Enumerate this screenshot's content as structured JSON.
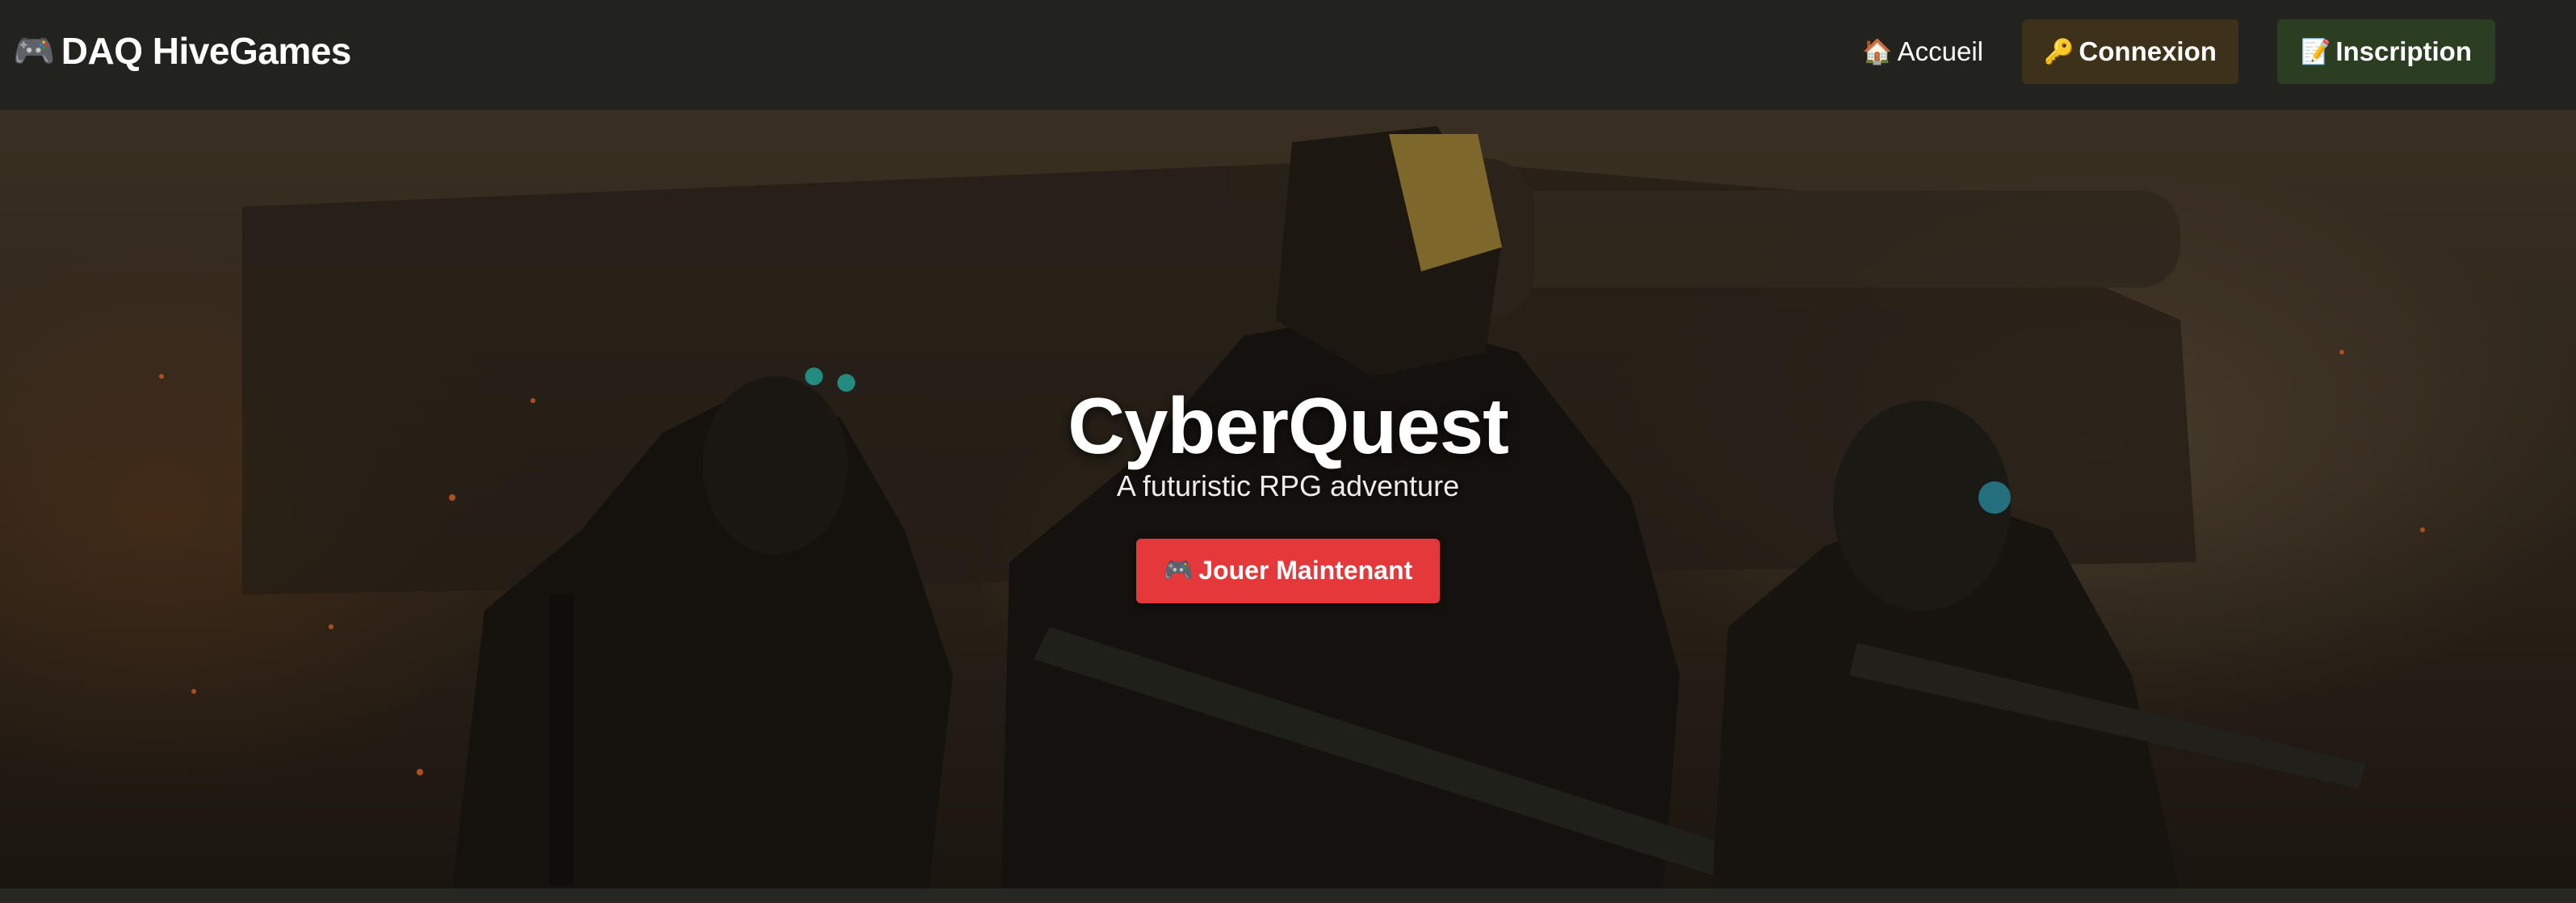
{
  "brand": {
    "icon": "🎮",
    "name": "DAQ HiveGames"
  },
  "nav": {
    "home": {
      "icon": "🏠",
      "label": "Accueil"
    },
    "login": {
      "icon": "🔑",
      "label": "Connexion"
    },
    "signup": {
      "icon": "📝",
      "label": "Inscription"
    }
  },
  "hero": {
    "title": "CyberQuest",
    "subtitle": "A futuristic RPG adventure",
    "cta": {
      "icon": "🎮",
      "label": "Jouer Maintenant"
    }
  },
  "colors": {
    "navbar_bg": "#22221e",
    "login_bg": "#3d3219",
    "signup_bg": "#2c3e22",
    "cta_bg": "#e5383b"
  }
}
